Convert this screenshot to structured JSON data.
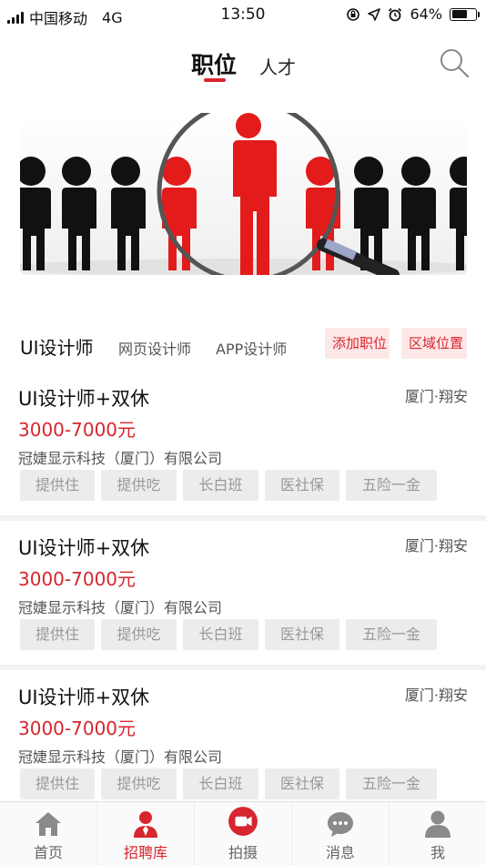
{
  "status_bar": {
    "carrier": "中国移动",
    "network": "4G",
    "time": "13:50",
    "battery": "64%",
    "battery_level": 0.64
  },
  "header": {
    "tab_jobs": "职位",
    "tab_talent": "人才"
  },
  "categories": {
    "active": "UI设计师",
    "items": [
      "网页设计师",
      "APP设计师"
    ],
    "add_job": "添加职位",
    "area": "区域位置"
  },
  "jobs": [
    {
      "title": "UI设计师+双休",
      "location": "厦门·翔安",
      "salary": "3000-7000元",
      "company": "冠婕显示科技（厦门）有限公司",
      "tags": [
        "提供住",
        "提供吃",
        "长白班",
        "医社保",
        "五险一金"
      ]
    },
    {
      "title": "UI设计师+双休",
      "location": "厦门·翔安",
      "salary": "3000-7000元",
      "company": "冠婕显示科技（厦门）有限公司",
      "tags": [
        "提供住",
        "提供吃",
        "长白班",
        "医社保",
        "五险一金"
      ]
    },
    {
      "title": "UI设计师+双休",
      "location": "厦门·翔安",
      "salary": "3000-7000元",
      "company": "冠婕显示科技（厦门）有限公司",
      "tags": [
        "提供住",
        "提供吃",
        "长白班",
        "医社保",
        "五险一金"
      ]
    }
  ],
  "bottom_nav": [
    {
      "label": "首页",
      "icon": "home-icon"
    },
    {
      "label": "招聘库",
      "icon": "recruit-icon"
    },
    {
      "label": "拍摄",
      "icon": "camera-icon"
    },
    {
      "label": "消息",
      "icon": "message-icon"
    },
    {
      "label": "我",
      "icon": "profile-icon"
    }
  ],
  "colors": {
    "accent": "#d7262e",
    "tag_bg": "#ececec",
    "tag_text": "#999999"
  }
}
